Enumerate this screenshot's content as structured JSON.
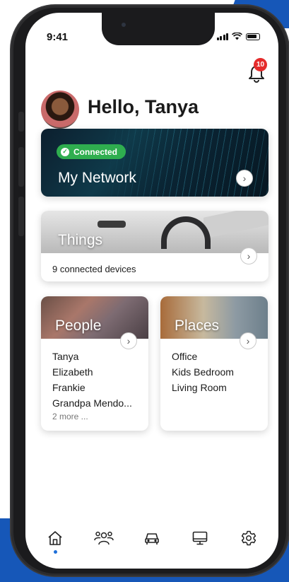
{
  "status_bar": {
    "time": "9:41"
  },
  "notifications": {
    "count": "10"
  },
  "greeting": "Hello, Tanya",
  "network_card": {
    "status": "Connected",
    "title": "My Network"
  },
  "things_card": {
    "title": "Things",
    "subtitle": "9 connected devices"
  },
  "people_card": {
    "title": "People",
    "names": [
      "Tanya",
      "Elizabeth",
      "Frankie",
      "Grandpa Mendo..."
    ],
    "more": "2 more ..."
  },
  "places_card": {
    "title": "Places",
    "names": [
      "Office",
      "Kids Bedroom",
      "Living Room"
    ]
  },
  "tabbar": {
    "active": "home",
    "icons": [
      "home-icon",
      "people-icon",
      "car-icon",
      "monitor-icon",
      "settings-icon"
    ]
  },
  "colors": {
    "accent": "#1e6fd9",
    "connected": "#2fae4f",
    "badge": "#e52b2b",
    "brand_blue": "#1657b8"
  }
}
